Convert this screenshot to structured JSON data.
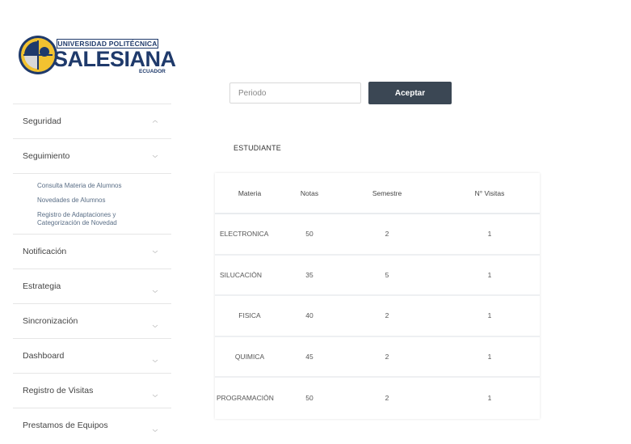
{
  "logo": {
    "top": "UNIVERSIDAD POLITÉCNICA",
    "main": "SALESIANA",
    "sub": "ECUADOR"
  },
  "sidebar": {
    "items": [
      {
        "label": "Seguridad",
        "icon": "chevron-up-icon"
      },
      {
        "label": "Seguimiento",
        "icon": "chevron-down-icon"
      },
      {
        "label": "Notificación",
        "icon": "chevron-down-icon"
      },
      {
        "label": "Estrategia",
        "icon": "chevron-down-icon"
      },
      {
        "label": "Sincronización",
        "icon": "chevron-down-icon"
      },
      {
        "label": "Dashboard",
        "icon": "chevron-down-icon"
      },
      {
        "label": "Registro de Visitas",
        "icon": "chevron-down-icon"
      },
      {
        "label": "Prestamos de Equipos",
        "icon": "chevron-down-icon"
      }
    ],
    "submenu": [
      "Consulta Materia de Alumnos",
      "Novedades de Alumnos",
      "Registro de Adaptaciones y Categorización de Novedad"
    ]
  },
  "controls": {
    "periodo_placeholder": "Periodo",
    "aceptar_label": "Aceptar"
  },
  "section_label": "ESTUDIANTE",
  "table": {
    "headers": [
      "Materia",
      "Notas",
      "Semestre",
      "N° Visitas"
    ],
    "rows": [
      [
        "ELECTRONICA",
        "50",
        "2",
        "1"
      ],
      [
        "SILUCACIÒN",
        "35",
        "5",
        "1"
      ],
      [
        "FISICA",
        "40",
        "2",
        "1"
      ],
      [
        "QUIMICA",
        "45",
        "2",
        "1"
      ],
      [
        "PROGRAMACIÒN",
        "50",
        "2",
        "1"
      ]
    ]
  },
  "colors": {
    "brand_blue": "#1f3a6b",
    "button_dark": "#3b4754",
    "submenu_text": "#5a6e86"
  }
}
